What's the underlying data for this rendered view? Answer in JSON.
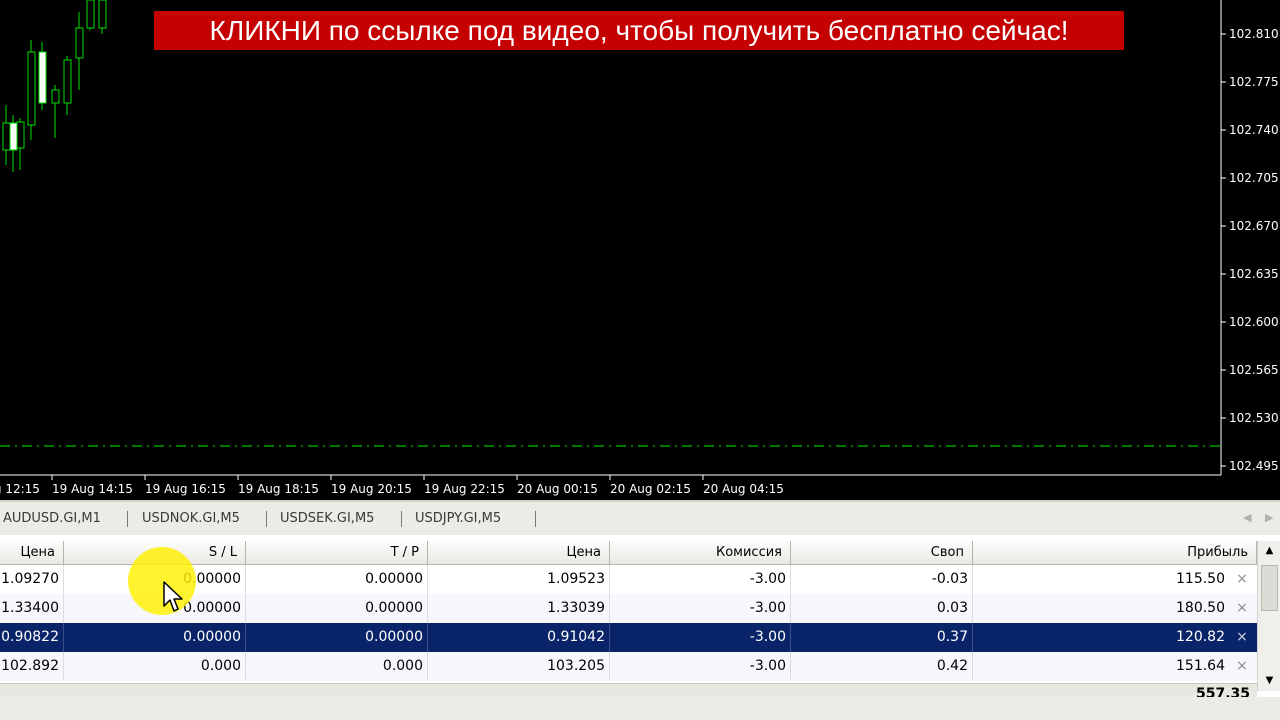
{
  "promo_banner": "КЛИКНИ по ссылке под видео, чтобы получить бесплатно сейчас!",
  "price_axis": [
    "102.810",
    "102.775",
    "102.740",
    "102.705",
    "102.670",
    "102.635",
    "102.600",
    "102.565",
    "102.530",
    "102.495"
  ],
  "time_axis": [
    "19 Aug 12:15",
    "19 Aug 14:15",
    "19 Aug 16:15",
    "19 Aug 18:15",
    "19 Aug 20:15",
    "19 Aug 22:15",
    "20 Aug 00:15",
    "20 Aug 02:15",
    "20 Aug 04:15"
  ],
  "chart_tabs": [
    {
      "label": "AUDUSD.GI,M1"
    },
    {
      "label": "USDNOK.GI,M5"
    },
    {
      "label": "USDSEK.GI,M5"
    },
    {
      "label": "USDJPY.GI,M5"
    }
  ],
  "table": {
    "headers": [
      "Цена",
      "S / L",
      "T / P",
      "Цена",
      "Комиссия",
      "Своп",
      "Прибыль"
    ],
    "rows": [
      {
        "open_price": "1.09270",
        "sl": "0.00000",
        "tp": "0.00000",
        "price": "1.09523",
        "commission": "-3.00",
        "swap": "-0.03",
        "profit": "115.50",
        "selected": false
      },
      {
        "open_price": "1.33400",
        "sl": "0.00000",
        "tp": "0.00000",
        "price": "1.33039",
        "commission": "-3.00",
        "swap": "0.03",
        "profit": "180.50",
        "selected": false
      },
      {
        "open_price": "0.90822",
        "sl": "0.00000",
        "tp": "0.00000",
        "price": "0.91042",
        "commission": "-3.00",
        "swap": "0.37",
        "profit": "120.82",
        "selected": true
      },
      {
        "open_price": "102.892",
        "sl": "0.000",
        "tp": "0.000",
        "price": "103.205",
        "commission": "-3.00",
        "swap": "0.42",
        "profit": "151.64",
        "selected": false
      }
    ],
    "total_profit": "557.35",
    "close_glyph": "×"
  },
  "colors": {
    "bull_candle": "#00e000",
    "level_line": "#00c000",
    "selection": "#0a246a",
    "promo_bg": "#c40000"
  }
}
